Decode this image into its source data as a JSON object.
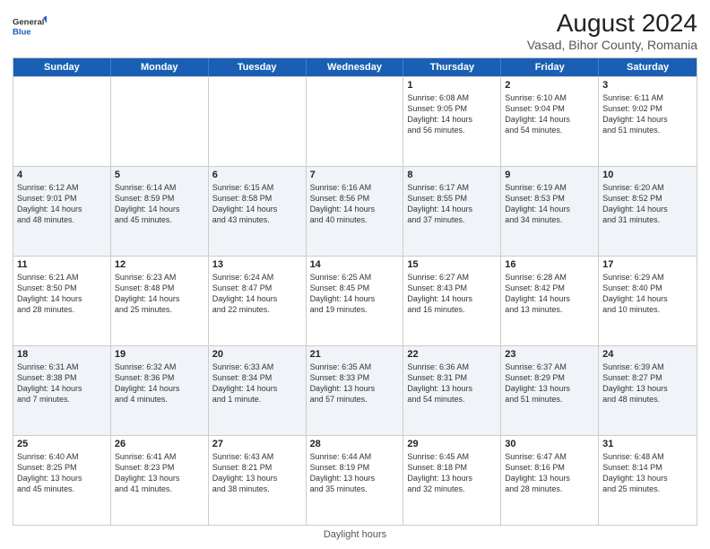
{
  "header": {
    "logo_line1": "General",
    "logo_line2": "Blue",
    "main_title": "August 2024",
    "subtitle": "Vasad, Bihor County, Romania"
  },
  "footer": {
    "daylight_label": "Daylight hours"
  },
  "weekdays": [
    "Sunday",
    "Monday",
    "Tuesday",
    "Wednesday",
    "Thursday",
    "Friday",
    "Saturday"
  ],
  "rows": [
    {
      "alt": false,
      "cells": [
        {
          "day": "",
          "content": ""
        },
        {
          "day": "",
          "content": ""
        },
        {
          "day": "",
          "content": ""
        },
        {
          "day": "",
          "content": ""
        },
        {
          "day": "1",
          "content": "Sunrise: 6:08 AM\nSunset: 9:05 PM\nDaylight: 14 hours\nand 56 minutes."
        },
        {
          "day": "2",
          "content": "Sunrise: 6:10 AM\nSunset: 9:04 PM\nDaylight: 14 hours\nand 54 minutes."
        },
        {
          "day": "3",
          "content": "Sunrise: 6:11 AM\nSunset: 9:02 PM\nDaylight: 14 hours\nand 51 minutes."
        }
      ]
    },
    {
      "alt": true,
      "cells": [
        {
          "day": "4",
          "content": "Sunrise: 6:12 AM\nSunset: 9:01 PM\nDaylight: 14 hours\nand 48 minutes."
        },
        {
          "day": "5",
          "content": "Sunrise: 6:14 AM\nSunset: 8:59 PM\nDaylight: 14 hours\nand 45 minutes."
        },
        {
          "day": "6",
          "content": "Sunrise: 6:15 AM\nSunset: 8:58 PM\nDaylight: 14 hours\nand 43 minutes."
        },
        {
          "day": "7",
          "content": "Sunrise: 6:16 AM\nSunset: 8:56 PM\nDaylight: 14 hours\nand 40 minutes."
        },
        {
          "day": "8",
          "content": "Sunrise: 6:17 AM\nSunset: 8:55 PM\nDaylight: 14 hours\nand 37 minutes."
        },
        {
          "day": "9",
          "content": "Sunrise: 6:19 AM\nSunset: 8:53 PM\nDaylight: 14 hours\nand 34 minutes."
        },
        {
          "day": "10",
          "content": "Sunrise: 6:20 AM\nSunset: 8:52 PM\nDaylight: 14 hours\nand 31 minutes."
        }
      ]
    },
    {
      "alt": false,
      "cells": [
        {
          "day": "11",
          "content": "Sunrise: 6:21 AM\nSunset: 8:50 PM\nDaylight: 14 hours\nand 28 minutes."
        },
        {
          "day": "12",
          "content": "Sunrise: 6:23 AM\nSunset: 8:48 PM\nDaylight: 14 hours\nand 25 minutes."
        },
        {
          "day": "13",
          "content": "Sunrise: 6:24 AM\nSunset: 8:47 PM\nDaylight: 14 hours\nand 22 minutes."
        },
        {
          "day": "14",
          "content": "Sunrise: 6:25 AM\nSunset: 8:45 PM\nDaylight: 14 hours\nand 19 minutes."
        },
        {
          "day": "15",
          "content": "Sunrise: 6:27 AM\nSunset: 8:43 PM\nDaylight: 14 hours\nand 16 minutes."
        },
        {
          "day": "16",
          "content": "Sunrise: 6:28 AM\nSunset: 8:42 PM\nDaylight: 14 hours\nand 13 minutes."
        },
        {
          "day": "17",
          "content": "Sunrise: 6:29 AM\nSunset: 8:40 PM\nDaylight: 14 hours\nand 10 minutes."
        }
      ]
    },
    {
      "alt": true,
      "cells": [
        {
          "day": "18",
          "content": "Sunrise: 6:31 AM\nSunset: 8:38 PM\nDaylight: 14 hours\nand 7 minutes."
        },
        {
          "day": "19",
          "content": "Sunrise: 6:32 AM\nSunset: 8:36 PM\nDaylight: 14 hours\nand 4 minutes."
        },
        {
          "day": "20",
          "content": "Sunrise: 6:33 AM\nSunset: 8:34 PM\nDaylight: 14 hours\nand 1 minute."
        },
        {
          "day": "21",
          "content": "Sunrise: 6:35 AM\nSunset: 8:33 PM\nDaylight: 13 hours\nand 57 minutes."
        },
        {
          "day": "22",
          "content": "Sunrise: 6:36 AM\nSunset: 8:31 PM\nDaylight: 13 hours\nand 54 minutes."
        },
        {
          "day": "23",
          "content": "Sunrise: 6:37 AM\nSunset: 8:29 PM\nDaylight: 13 hours\nand 51 minutes."
        },
        {
          "day": "24",
          "content": "Sunrise: 6:39 AM\nSunset: 8:27 PM\nDaylight: 13 hours\nand 48 minutes."
        }
      ]
    },
    {
      "alt": false,
      "cells": [
        {
          "day": "25",
          "content": "Sunrise: 6:40 AM\nSunset: 8:25 PM\nDaylight: 13 hours\nand 45 minutes."
        },
        {
          "day": "26",
          "content": "Sunrise: 6:41 AM\nSunset: 8:23 PM\nDaylight: 13 hours\nand 41 minutes."
        },
        {
          "day": "27",
          "content": "Sunrise: 6:43 AM\nSunset: 8:21 PM\nDaylight: 13 hours\nand 38 minutes."
        },
        {
          "day": "28",
          "content": "Sunrise: 6:44 AM\nSunset: 8:19 PM\nDaylight: 13 hours\nand 35 minutes."
        },
        {
          "day": "29",
          "content": "Sunrise: 6:45 AM\nSunset: 8:18 PM\nDaylight: 13 hours\nand 32 minutes."
        },
        {
          "day": "30",
          "content": "Sunrise: 6:47 AM\nSunset: 8:16 PM\nDaylight: 13 hours\nand 28 minutes."
        },
        {
          "day": "31",
          "content": "Sunrise: 6:48 AM\nSunset: 8:14 PM\nDaylight: 13 hours\nand 25 minutes."
        }
      ]
    }
  ]
}
